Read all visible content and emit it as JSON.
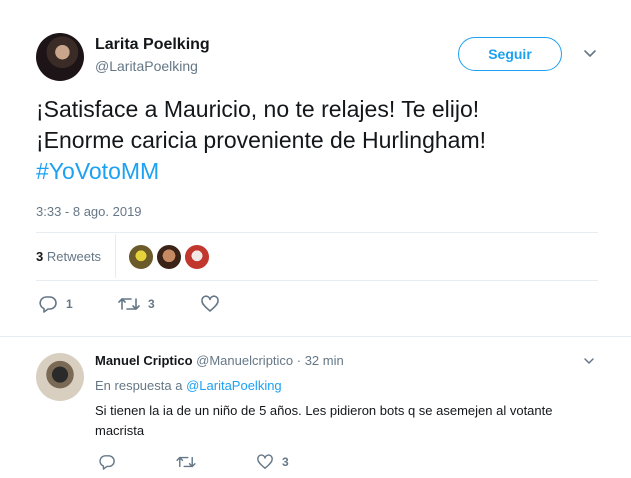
{
  "author": {
    "name": "Larita Poelking",
    "handle": "@LaritaPoelking"
  },
  "follow_label": "Seguir",
  "tweet": {
    "line1": "¡Satisface a Mauricio, no te relajes! Te elijo!",
    "line2": "¡Enorme caricia proveniente de Hurlingham!",
    "hashtag": "#YoVotoMM",
    "timestamp": "3:33 - 8 ago. 2019"
  },
  "retweets": {
    "count": "3",
    "label": "Retweets"
  },
  "actions": {
    "reply_count": "1",
    "retweet_count": "3",
    "like_count": ""
  },
  "reply": {
    "name": "Manuel Criptico",
    "handle_time": "@Manuelcriptico · 32 min",
    "in_reply_prefix": "En respuesta a",
    "in_reply_handle": "@LaritaPoelking",
    "text": "Si tienen la ia de un niño de 5 años. Les pidieron bots q se asemejen al votante macrista",
    "actions": {
      "reply_count": "",
      "retweet_count": "",
      "like_count": "3"
    }
  },
  "colors": {
    "accent": "#1da1f2",
    "muted": "#657786",
    "text": "#14171a",
    "border": "#e6ecf0"
  },
  "icons": [
    "caret-down-icon",
    "reply-icon",
    "retweet-icon",
    "like-icon"
  ]
}
